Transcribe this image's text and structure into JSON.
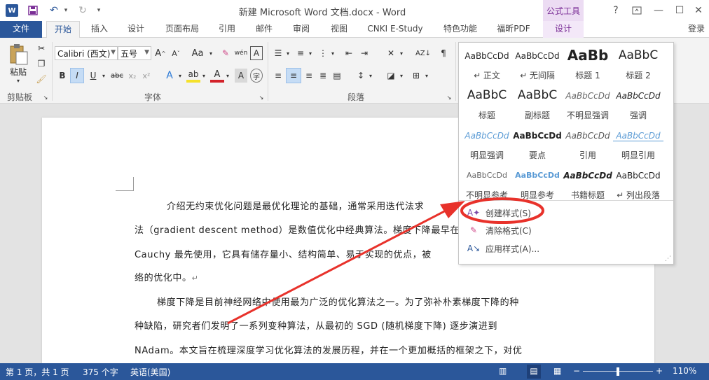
{
  "titlebar": {
    "app_icon_letter": "W",
    "title": "新建 Microsoft Word 文档.docx - Word",
    "context_group": "公式工具",
    "help": "?",
    "restore_icon": "ribbon-display-icon",
    "minimize": "—",
    "maximize": "☐",
    "close": "✕"
  },
  "tabs": {
    "file": "文件",
    "home": "开始",
    "insert": "插入",
    "design": "设计",
    "layout": "页面布局",
    "references": "引用",
    "mailings": "邮件",
    "review": "审阅",
    "view": "视图",
    "cnki": "CNKI E-Study",
    "special": "特色功能",
    "foxit": "福昕PDF",
    "eq_design": "设计",
    "login": "登录"
  },
  "ribbon": {
    "clipboard": {
      "paste": "粘贴",
      "label": "剪贴板"
    },
    "font": {
      "family": "Calibri (西文)",
      "size": "五号",
      "grow": "A",
      "shrink": "A",
      "case": "Aa",
      "bold": "B",
      "italic": "I",
      "underline": "U",
      "strike": "abc",
      "sub": "x₂",
      "sup": "x²",
      "wen": "wén",
      "label": "字体"
    },
    "paragraph": {
      "label": "段落"
    }
  },
  "styles_gallery": {
    "styles": [
      {
        "preview": "AaBbCcDd",
        "name": "↵ 正文"
      },
      {
        "preview": "AaBbCcDd",
        "name": "↵ 无间隔"
      },
      {
        "preview": "AaBb",
        "name": "标题 1"
      },
      {
        "preview": "AaBbC",
        "name": "标题 2"
      },
      {
        "preview": "AaBbC",
        "name": "标题"
      },
      {
        "preview": "AaBbC",
        "name": "副标题"
      },
      {
        "preview": "AaBbCcDd",
        "name": "不明显强调"
      },
      {
        "preview": "AaBbCcDd",
        "name": "强调"
      },
      {
        "preview": "AaBbCcDd",
        "name": "明显强调"
      },
      {
        "preview": "AaBbCcDd",
        "name": "要点"
      },
      {
        "preview": "AaBbCcDd",
        "name": "引用"
      },
      {
        "preview": "AaBbCcDd",
        "name": "明显引用"
      },
      {
        "preview": "AaBbCcDd",
        "name": "不明显参考"
      },
      {
        "preview": "AaBbCcDd",
        "name": "明显参考"
      },
      {
        "preview": "AaBbCcDd",
        "name": "书籍标题"
      },
      {
        "preview": "AaBbCcDd",
        "name": "↵ 列出段落"
      }
    ],
    "create_style": "创建样式(S)",
    "clear_format": "清除格式(C)",
    "apply_style": "应用样式(A)..."
  },
  "document": {
    "lines": [
      "介绍无约束优化问题是最优化理论的基础，通常采用迭代法求",
      "法（gradient descent method）是数值优化中经典算法。梯度下降最早在",
      "Cauchy  最先使用，它具有储存量小、结构简单、易于实现的优点，被",
      "络的优化中。",
      "梯度下降是目前神经网络中使用最为广泛的优化算法之一。为了弥补朴素梯度下降的种",
      "种缺陷，研究者们发明了一系列变种算法，从最初的  SGD (随机梯度下降)  逐步演进到",
      "NAdam。本文旨在梳理深度学习优化算法的发展历程，并在一个更加概括的框架之下，对优"
    ],
    "pilcrow": "↵"
  },
  "statusbar": {
    "page": "第 1 页，共 1 页",
    "words": "375 个字",
    "language": "英语(美国)",
    "zoom_minus": "−",
    "zoom_plus": "+",
    "zoom": "110%"
  },
  "colors": {
    "word_blue": "#2b579a",
    "context_purple": "#7b2f97",
    "annotation_red": "#e8322b"
  }
}
